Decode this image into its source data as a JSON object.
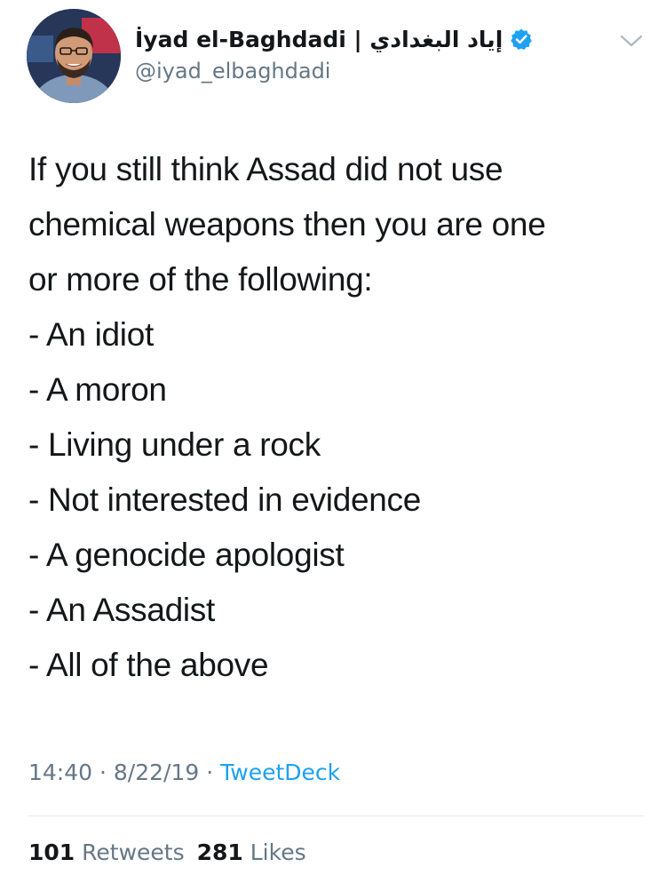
{
  "author": {
    "display_name": "İyad el-Baghdadi | إياد البغدادي",
    "handle": "@iyad_elbaghdadi",
    "verified": true,
    "avatar": "profile-photo"
  },
  "tweet": {
    "lines": [
      "If you still think Assad did not use",
      "chemical weapons then you are one",
      "or more of the following:",
      "- An idiot",
      "- A moron",
      "- Living under a rock",
      "- Not interested in evidence",
      "- A genocide apologist",
      "- An Assadist",
      "- All of the above"
    ]
  },
  "meta": {
    "time": "14:40",
    "separator": "·",
    "date": "8/22/19",
    "source": "TweetDeck"
  },
  "stats": {
    "retweets_count": "101",
    "retweets_label": "Retweets",
    "likes_count": "281",
    "likes_label": "Likes"
  },
  "icons": {
    "verified": "verified-badge-icon",
    "menu": "chevron-down-icon"
  },
  "colors": {
    "text": "#14171a",
    "secondary": "#657786",
    "accent": "#1da1f2",
    "divider": "#e1e8ed"
  }
}
